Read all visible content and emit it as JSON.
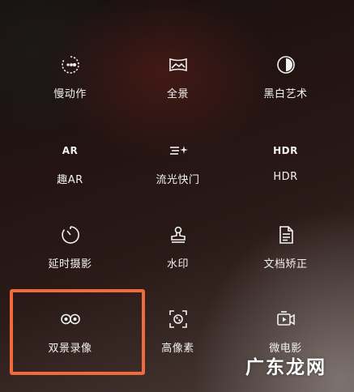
{
  "modes": [
    {
      "label": "慢动作",
      "icon": "slow-motion-icon"
    },
    {
      "label": "全景",
      "icon": "panorama-icon"
    },
    {
      "label": "黑白艺术",
      "icon": "monochrome-art-icon"
    },
    {
      "label": "趣AR",
      "icon": "ar-icon",
      "icon_text": "AR"
    },
    {
      "label": "流光快门",
      "icon": "light-trail-shutter-icon"
    },
    {
      "label": "HDR",
      "icon": "hdr-icon",
      "icon_text": "HDR"
    },
    {
      "label": "延时摄影",
      "icon": "timelapse-icon"
    },
    {
      "label": "水印",
      "icon": "watermark-stamp-icon"
    },
    {
      "label": "文档矫正",
      "icon": "document-correction-icon"
    },
    {
      "label": "双景录像",
      "icon": "dual-view-video-icon"
    },
    {
      "label": "高像素",
      "icon": "high-pixel-icon"
    },
    {
      "label": "微电影",
      "icon": "micro-movie-icon"
    }
  ],
  "highlight_color": "#f06a3c",
  "watermark": "广东龙网"
}
